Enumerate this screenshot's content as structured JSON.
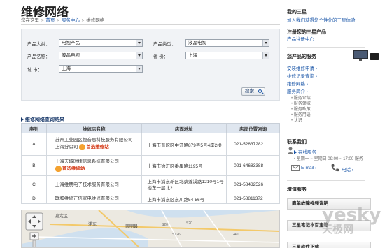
{
  "page": {
    "title": "维修网络",
    "breadcrumb": {
      "prefix": "您在这里",
      "home": "首页",
      "sep": ">",
      "section": "服务中心",
      "current": "维修网络"
    }
  },
  "search": {
    "product_category_label": "产品大类：",
    "product_category_value": "电视产品",
    "product_type_label": "产品类型：",
    "product_type_value": "液晶电视",
    "product_name_label": "产品名称：",
    "product_name_value": "液晶电视",
    "province_label": "省 份：",
    "province_value": "上海",
    "city_label": "城 市：",
    "city_value": "上海",
    "button_label": "搜索"
  },
  "results": {
    "heading": "维修网络查询结果",
    "columns": [
      "序列",
      "维修店名称",
      "店面地址",
      "店面位置咨询"
    ],
    "rows": [
      {
        "seq": "A",
        "name_line1": "苏州工业园区恒音思科技服务有限公司",
        "name_line2": "上海分公司",
        "badge": "首选维修站",
        "address": "上海市普陀区中江路879弄5号4座2楼",
        "phone": "021-52837282"
      },
      {
        "seq": "B",
        "name_line1": "上海天域时捷信息系统有限公司",
        "name_line2": "",
        "badge": "首选维修站",
        "address": "上海市徐汇区番禺路1195号",
        "phone": "021-64683388"
      },
      {
        "seq": "C",
        "name_line1": "上海维朋电子技术服务有限公司",
        "name_line2": "",
        "badge": "",
        "address": "上海市浦东新区北蔡莲溪路1210号1号楼东一层北2",
        "phone": "021-58432526"
      },
      {
        "seq": "D",
        "name_line1": "联和维修正信家电维修有限公司",
        "name_line2": "",
        "badge": "",
        "address": "上海市浦东区东川路54-56号",
        "phone": "021-58811372"
      }
    ]
  },
  "map": {
    "labels": [
      "嘉定区",
      "浦东",
      "崇明县",
      "S20",
      "S20",
      "S126",
      "G40"
    ]
  },
  "sidebar": {
    "my_samsung_title": "我的三星",
    "my_samsung_link": "加入我们获得您个性化的三星体验",
    "register_title": "注册您的三星产品",
    "register_link": "产品注册中心",
    "services_title": "您产品的服务",
    "services_links": [
      "安装维修申请",
      "维修记录查询",
      "维修网络",
      "服务简介"
    ],
    "services_subs": [
      "服务介绍",
      "服务领域",
      "服务政策",
      "服务用语",
      "认识"
    ],
    "contact_title": "联系我们",
    "contact_online_label": "在线服务",
    "contact_hours": "星期一 ~ 星期日 09:00 ~ 17:00 服务",
    "email_label": "E-mail",
    "phone_label": "电话",
    "value_added_title": "增值服务",
    "value_added_items": [
      "简单故障视频说明",
      "三星笔记本百宝箱",
      "三星软件下载"
    ]
  },
  "watermark": {
    "line1": "yesky",
    "line2": "天极网"
  }
}
